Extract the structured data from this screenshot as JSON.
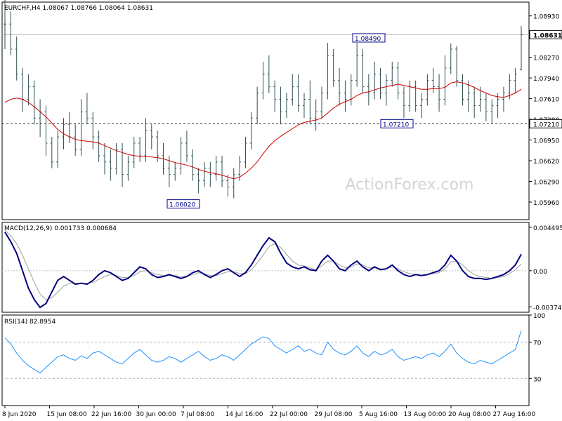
{
  "chart_data": [
    {
      "type": "bar",
      "panel": "price",
      "header": "EURCHF,H4  1.08067 1.08766 1.08064 1.08631",
      "watermark": "ActionForex.com",
      "ylim": [
        1.0568,
        1.0915
      ],
      "yticks": [
        "1.08930",
        "1.08270",
        "1.07940",
        "1.07610",
        "1.07280",
        "1.06950",
        "1.06620",
        "1.06290",
        "1.05960"
      ],
      "current_price": "1.08631",
      "horizontal_line": "1.07210",
      "annotations": [
        {
          "label": "1.06020",
          "x": 218,
          "y": 1.0602
        },
        {
          "label": "1.08490",
          "x": 482,
          "y": 1.0849
        },
        {
          "label": "1.07210",
          "x": 522,
          "y": 1.0721
        }
      ],
      "bars": [
        [
          1.088,
          1.093,
          1.084,
          1.088
        ],
        [
          1.088,
          1.09,
          1.083,
          1.084
        ],
        [
          1.084,
          1.086,
          1.079,
          1.08
        ],
        [
          1.08,
          1.081,
          1.074,
          1.076
        ],
        [
          1.076,
          1.08,
          1.075,
          1.078
        ],
        [
          1.078,
          1.079,
          1.072,
          1.073
        ],
        [
          1.073,
          1.076,
          1.07,
          1.074
        ],
        [
          1.074,
          1.075,
          1.067,
          1.069
        ],
        [
          1.069,
          1.07,
          1.065,
          1.066
        ],
        [
          1.066,
          1.071,
          1.065,
          1.07
        ],
        [
          1.07,
          1.073,
          1.068,
          1.072
        ],
        [
          1.072,
          1.074,
          1.069,
          1.07
        ],
        [
          1.07,
          1.072,
          1.067,
          1.068
        ],
        [
          1.068,
          1.076,
          1.067,
          1.074
        ],
        [
          1.074,
          1.077,
          1.072,
          1.073
        ],
        [
          1.073,
          1.074,
          1.068,
          1.07
        ],
        [
          1.07,
          1.071,
          1.066,
          1.067
        ],
        [
          1.067,
          1.069,
          1.064,
          1.066
        ],
        [
          1.066,
          1.068,
          1.063,
          1.065
        ],
        [
          1.065,
          1.069,
          1.064,
          1.068
        ],
        [
          1.068,
          1.069,
          1.062,
          1.064
        ],
        [
          1.064,
          1.067,
          1.063,
          1.066
        ],
        [
          1.066,
          1.07,
          1.065,
          1.069
        ],
        [
          1.069,
          1.07,
          1.066,
          1.067
        ],
        [
          1.067,
          1.073,
          1.066,
          1.071
        ],
        [
          1.071,
          1.072,
          1.068,
          1.07
        ],
        [
          1.07,
          1.071,
          1.066,
          1.067
        ],
        [
          1.067,
          1.069,
          1.064,
          1.065
        ],
        [
          1.065,
          1.067,
          1.062,
          1.064
        ],
        [
          1.064,
          1.066,
          1.063,
          1.065
        ],
        [
          1.065,
          1.07,
          1.064,
          1.069
        ],
        [
          1.069,
          1.071,
          1.066,
          1.067
        ],
        [
          1.067,
          1.068,
          1.063,
          1.064
        ],
        [
          1.064,
          1.065,
          1.061,
          1.063
        ],
        [
          1.063,
          1.066,
          1.062,
          1.065
        ],
        [
          1.065,
          1.066,
          1.062,
          1.064
        ],
        [
          1.064,
          1.067,
          1.063,
          1.066
        ],
        [
          1.066,
          1.067,
          1.062,
          1.063
        ],
        [
          1.063,
          1.064,
          1.0605,
          1.062
        ],
        [
          1.062,
          1.065,
          1.0602,
          1.064
        ],
        [
          1.064,
          1.067,
          1.063,
          1.066
        ],
        [
          1.066,
          1.07,
          1.065,
          1.069
        ],
        [
          1.069,
          1.074,
          1.068,
          1.073
        ],
        [
          1.073,
          1.078,
          1.072,
          1.077
        ],
        [
          1.077,
          1.082,
          1.076,
          1.08
        ],
        [
          1.08,
          1.083,
          1.077,
          1.078
        ],
        [
          1.078,
          1.079,
          1.074,
          1.076
        ],
        [
          1.076,
          1.078,
          1.072,
          1.074
        ],
        [
          1.074,
          1.077,
          1.073,
          1.076
        ],
        [
          1.076,
          1.08,
          1.075,
          1.078
        ],
        [
          1.078,
          1.08,
          1.074,
          1.075
        ],
        [
          1.075,
          1.077,
          1.073,
          1.076
        ],
        [
          1.076,
          1.079,
          1.072,
          1.073
        ],
        [
          1.073,
          1.076,
          1.071,
          1.074
        ],
        [
          1.074,
          1.078,
          1.073,
          1.077
        ],
        [
          1.077,
          1.085,
          1.076,
          1.083
        ],
        [
          1.083,
          1.084,
          1.078,
          1.079
        ],
        [
          1.079,
          1.081,
          1.075,
          1.077
        ],
        [
          1.077,
          1.079,
          1.074,
          1.076
        ],
        [
          1.076,
          1.08,
          1.075,
          1.079
        ],
        [
          1.079,
          1.085,
          1.078,
          1.083
        ],
        [
          1.083,
          1.084,
          1.077,
          1.078
        ],
        [
          1.078,
          1.08,
          1.075,
          1.077
        ],
        [
          1.077,
          1.082,
          1.076,
          1.08
        ],
        [
          1.08,
          1.081,
          1.076,
          1.077
        ],
        [
          1.077,
          1.08,
          1.075,
          1.079
        ],
        [
          1.079,
          1.082,
          1.078,
          1.081
        ],
        [
          1.081,
          1.082,
          1.076,
          1.077
        ],
        [
          1.077,
          1.078,
          1.073,
          1.075
        ],
        [
          1.075,
          1.079,
          1.074,
          1.078
        ],
        [
          1.078,
          1.079,
          1.074,
          1.075
        ],
        [
          1.075,
          1.077,
          1.073,
          1.076
        ],
        [
          1.076,
          1.08,
          1.075,
          1.079
        ],
        [
          1.079,
          1.081,
          1.077,
          1.078
        ],
        [
          1.078,
          1.08,
          1.074,
          1.076
        ],
        [
          1.076,
          1.083,
          1.075,
          1.081
        ],
        [
          1.081,
          1.0849,
          1.08,
          1.084
        ],
        [
          1.084,
          1.0845,
          1.078,
          1.079
        ],
        [
          1.079,
          1.08,
          1.075,
          1.076
        ],
        [
          1.076,
          1.079,
          1.074,
          1.077
        ],
        [
          1.077,
          1.078,
          1.073,
          1.075
        ],
        [
          1.075,
          1.078,
          1.074,
          1.076
        ],
        [
          1.076,
          1.077,
          1.0725,
          1.074
        ],
        [
          1.074,
          1.076,
          1.0721,
          1.075
        ],
        [
          1.075,
          1.077,
          1.073,
          1.076
        ],
        [
          1.076,
          1.078,
          1.074,
          1.077
        ],
        [
          1.077,
          1.08,
          1.076,
          1.079
        ],
        [
          1.079,
          1.081,
          1.077,
          1.08
        ],
        [
          1.0807,
          1.0877,
          1.0806,
          1.0863
        ]
      ],
      "ma": [
        1.0755,
        1.076,
        1.0762,
        1.076,
        1.0755,
        1.0748,
        1.074,
        1.0732,
        1.0722,
        1.0712,
        1.0705,
        1.07,
        1.0696,
        1.0694,
        1.0693,
        1.0692,
        1.069,
        1.0686,
        1.0682,
        1.0678,
        1.0675,
        1.0672,
        1.067,
        1.0669,
        1.0669,
        1.0668,
        1.0667,
        1.0665,
        1.0662,
        1.0659,
        1.0657,
        1.0655,
        1.0652,
        1.0648,
        1.0645,
        1.0643,
        1.0641,
        1.0639,
        1.0636,
        1.0633,
        1.0636,
        1.0642,
        1.065,
        1.066,
        1.0673,
        1.0685,
        1.0694,
        1.0701,
        1.0707,
        1.0713,
        1.0719,
        1.0723,
        1.0725,
        1.0727,
        1.073,
        1.0738,
        1.0746,
        1.0752,
        1.0756,
        1.076,
        1.0766,
        1.077,
        1.0772,
        1.0775,
        1.0778,
        1.078,
        1.0782,
        1.0784,
        1.0782,
        1.078,
        1.0778,
        1.0776,
        1.0776,
        1.0777,
        1.0777,
        1.0779,
        1.0786,
        1.0788,
        1.0786,
        1.0783,
        1.0779,
        1.0774,
        1.077,
        1.0766,
        1.0764,
        1.0763,
        1.0766,
        1.077,
        1.0776
      ]
    },
    {
      "type": "line",
      "panel": "macd",
      "header": "MACD(12,26,9) 0.001733 0.000684",
      "ylim": [
        -0.0043,
        0.005
      ],
      "yticks": [
        "0.004495",
        "0.00",
        "-0.003743"
      ],
      "series": [
        {
          "name": "MACD",
          "values": [
            0.004,
            0.003,
            0.0018,
            0.0,
            -0.0018,
            -0.003,
            -0.0038,
            -0.0034,
            -0.0022,
            -0.001,
            -0.0006,
            -0.001,
            -0.0014,
            -0.0013,
            -0.0014,
            -0.001,
            -0.0004,
            0.0,
            -0.0002,
            -0.0006,
            -0.001,
            -0.0008,
            -0.0002,
            0.0004,
            0.0002,
            -0.0004,
            -0.0007,
            -0.0006,
            -0.0004,
            -0.0006,
            -0.0008,
            -0.0006,
            -0.0002,
            0.0,
            -0.0004,
            -0.0007,
            -0.0004,
            0.0,
            0.0002,
            -0.0002,
            -0.0006,
            -0.0002,
            0.0006,
            0.0016,
            0.0026,
            0.0034,
            0.003,
            0.0018,
            0.0008,
            0.0004,
            0.0002,
            0.0004,
            0.0001,
            0.0,
            0.001,
            0.0016,
            0.001,
            0.0002,
            0.0,
            0.0006,
            0.001,
            0.0004,
            0.0,
            0.0004,
            0.0001,
            0.0002,
            0.0006,
            0.0,
            -0.0004,
            -0.0006,
            -0.0004,
            -0.0005,
            -0.0004,
            -0.0002,
            0.0,
            0.0006,
            0.0016,
            0.001,
            0.0,
            -0.0006,
            -0.0008,
            -0.0008,
            -0.0009,
            -0.0008,
            -0.0006,
            -0.0004,
            0.0,
            0.0006,
            0.0017
          ]
        },
        {
          "name": "Signal",
          "values": [
            0.0042,
            0.0036,
            0.0028,
            0.0016,
            0.0002,
            -0.0012,
            -0.0024,
            -0.003,
            -0.0028,
            -0.0022,
            -0.0016,
            -0.0013,
            -0.0013,
            -0.0013,
            -0.0013,
            -0.0012,
            -0.0009,
            -0.0006,
            -0.0004,
            -0.0005,
            -0.0007,
            -0.0007,
            -0.0005,
            -0.0001,
            0.0,
            -0.0002,
            -0.0004,
            -0.0005,
            -0.0005,
            -0.0005,
            -0.0006,
            -0.0006,
            -0.0004,
            -0.0002,
            -0.0003,
            -0.0005,
            -0.0005,
            -0.0003,
            -0.0001,
            -0.0001,
            -0.0003,
            -0.0003,
            0.0001,
            0.0008,
            0.0016,
            0.0025,
            0.0028,
            0.0024,
            0.0017,
            0.001,
            0.0006,
            0.0005,
            0.0003,
            0.0001,
            0.0005,
            0.001,
            0.001,
            0.0006,
            0.0003,
            0.0004,
            0.0007,
            0.0006,
            0.0003,
            0.0003,
            0.0002,
            0.0002,
            0.0004,
            0.0002,
            -0.0001,
            -0.0003,
            -0.0004,
            -0.0005,
            -0.0004,
            -0.0003,
            -0.0002,
            0.0002,
            0.0009,
            0.001,
            0.0006,
            0.0,
            -0.0004,
            -0.0006,
            -0.0007,
            -0.0008,
            -0.0007,
            -0.0006,
            -0.0003,
            0.0001,
            0.0007
          ]
        }
      ]
    },
    {
      "type": "line",
      "panel": "rsi",
      "header": "RSI(14) 82.8954",
      "ylim": [
        0,
        100
      ],
      "yticks": [
        "100",
        "70",
        "30"
      ],
      "series": [
        {
          "name": "RSI(14)",
          "values": [
            75,
            68,
            58,
            50,
            44,
            40,
            36,
            42,
            48,
            54,
            56,
            52,
            50,
            55,
            52,
            58,
            60,
            56,
            52,
            48,
            46,
            52,
            58,
            62,
            56,
            50,
            48,
            50,
            54,
            52,
            48,
            52,
            56,
            60,
            54,
            50,
            52,
            56,
            54,
            50,
            56,
            62,
            68,
            72,
            76,
            74,
            66,
            62,
            58,
            62,
            66,
            60,
            62,
            58,
            56,
            70,
            62,
            58,
            56,
            60,
            66,
            58,
            54,
            60,
            56,
            58,
            62,
            54,
            50,
            52,
            54,
            52,
            56,
            58,
            54,
            60,
            68,
            58,
            52,
            48,
            46,
            50,
            48,
            46,
            50,
            54,
            58,
            62,
            83
          ]
        }
      ]
    }
  ],
  "x_axis": {
    "labels": [
      "8 Jun 2020",
      "15 Jun 08:00",
      "22 Jun 16:00",
      "30 Jun 00:00",
      "7 Jul 08:00",
      "14 Jul 16:00",
      "22 Jul 00:00",
      "29 Jul 08:00",
      "5 Aug 16:00",
      "13 Aug 00:00",
      "20 Aug 08:00",
      "27 Aug 16:00"
    ]
  }
}
